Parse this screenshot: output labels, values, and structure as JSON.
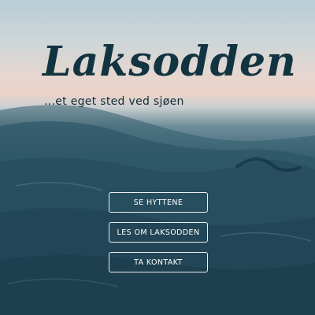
{
  "hero": {
    "title": "Laksodden",
    "tagline": "...et eget sted ved sjøen"
  },
  "buttons": [
    {
      "label": "SE HYTTENE"
    },
    {
      "label": "LES OM LAKSODDEN"
    },
    {
      "label": "TA KONTAKT"
    }
  ],
  "colors": {
    "title": "#123440",
    "sky": "#e6d6cf",
    "sea": "#2e5668",
    "button_border": "#ffffff"
  }
}
